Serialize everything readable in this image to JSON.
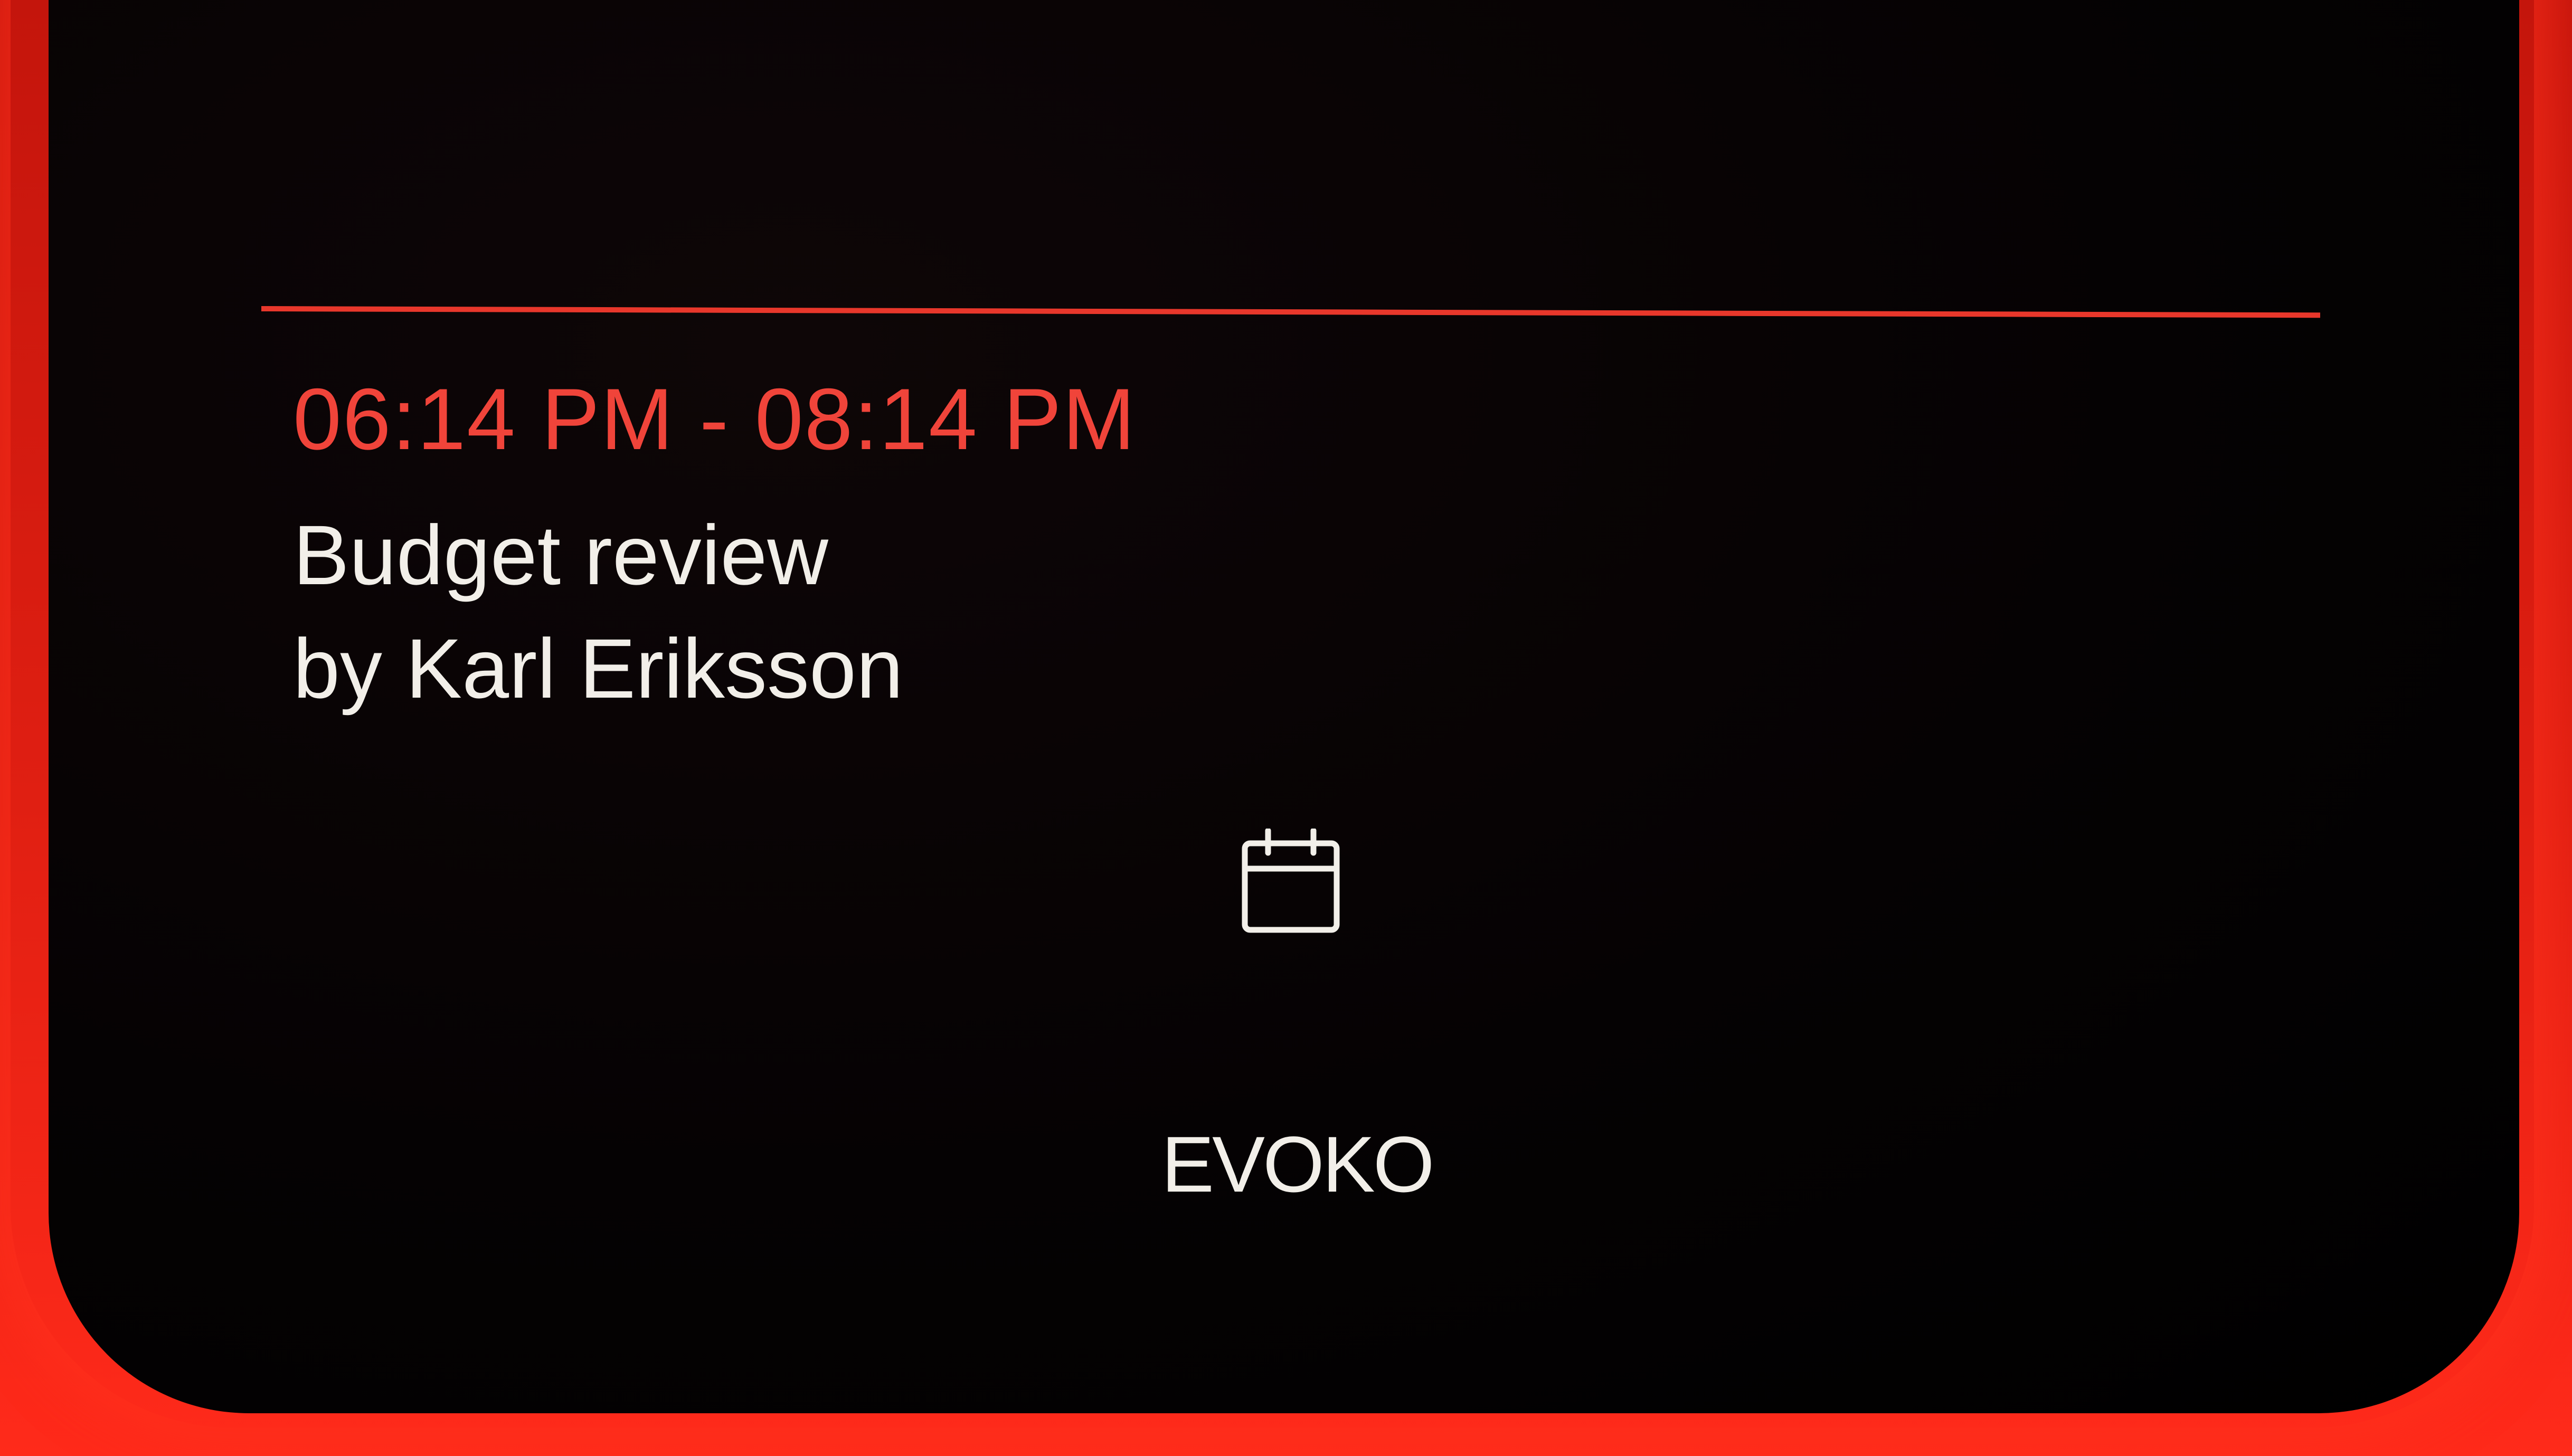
{
  "colors": {
    "bezel_red": "#e01f12",
    "screen_background": "#000000",
    "accent_red": "#f0443a",
    "text_white": "#f2efe9"
  },
  "booking": {
    "time_range": "06:14 PM - 08:14 PM",
    "title": "Budget review",
    "organizer": "by Karl Eriksson"
  },
  "calendar": {
    "icon": "calendar-icon"
  },
  "brand": {
    "name": "EVOKO"
  }
}
